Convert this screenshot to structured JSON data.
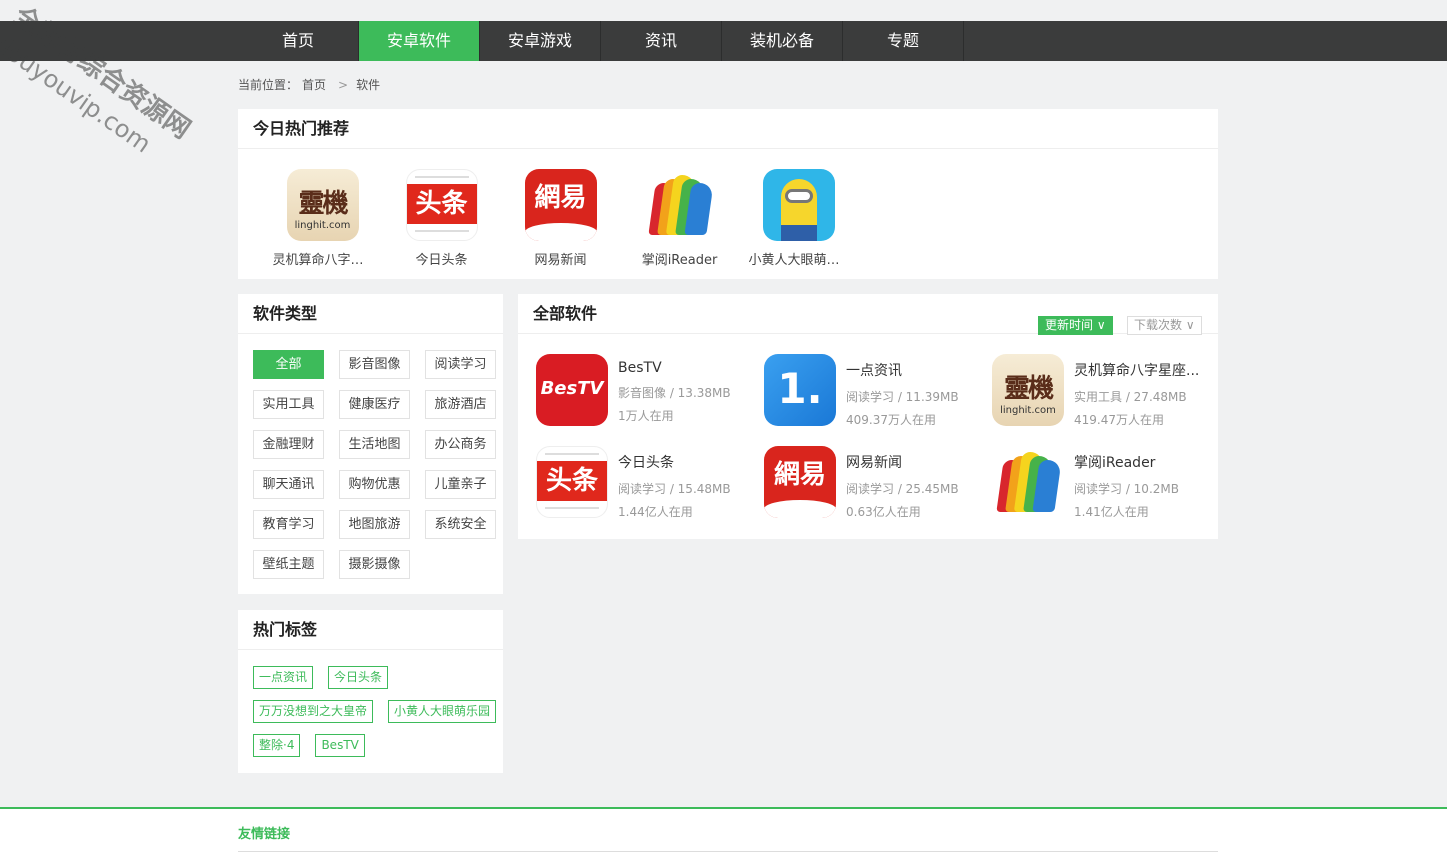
{
  "nav": {
    "items": [
      {
        "label": "首页",
        "active": false
      },
      {
        "label": "安卓软件",
        "active": true
      },
      {
        "label": "安卓游戏",
        "active": false
      },
      {
        "label": "资讯",
        "active": false
      },
      {
        "label": "装机必备",
        "active": false
      },
      {
        "label": "专题",
        "active": false
      }
    ]
  },
  "breadcrumb": {
    "prefix": "当前位置：",
    "home": "首页",
    "separator": ">",
    "current": "软件"
  },
  "hot": {
    "title": "今日热门推荐",
    "items": [
      {
        "name": "灵机算命八字星座...",
        "icon": "linghit-icon"
      },
      {
        "name": "今日头条",
        "icon": "toutiao-icon"
      },
      {
        "name": "网易新闻",
        "icon": "wangyi-news-icon"
      },
      {
        "name": "掌阅iReader",
        "icon": "ireader-icon"
      },
      {
        "name": "小黄人大眼萌乐园",
        "icon": "minion-icon"
      }
    ]
  },
  "categories": {
    "title": "软件类型",
    "items": [
      {
        "label": "全部",
        "active": true
      },
      {
        "label": "影音图像"
      },
      {
        "label": "阅读学习"
      },
      {
        "label": "实用工具"
      },
      {
        "label": "健康医疗"
      },
      {
        "label": "旅游酒店"
      },
      {
        "label": "金融理财"
      },
      {
        "label": "生活地图"
      },
      {
        "label": "办公商务"
      },
      {
        "label": "聊天通讯"
      },
      {
        "label": "购物优惠"
      },
      {
        "label": "儿童亲子"
      },
      {
        "label": "教育学习"
      },
      {
        "label": "地图旅游"
      },
      {
        "label": "系统安全"
      },
      {
        "label": "壁纸主题"
      },
      {
        "label": "摄影摄像"
      }
    ]
  },
  "tags": {
    "title": "热门标签",
    "rows": [
      [
        "一点资讯",
        "今日头条"
      ],
      [
        "万万没想到之大皇帝",
        "小黄人大眼萌乐园"
      ],
      [
        "整除·4",
        "BesTV"
      ]
    ]
  },
  "all": {
    "title": "全部软件",
    "sort_primary": "更新时间 ∨",
    "sort_secondary": "下载次数 ∨",
    "apps": [
      {
        "name": "BesTV",
        "meta": "影音图像 / 13.38MB",
        "users": "1万人在用",
        "icon": "bestv-icon"
      },
      {
        "name": "一点资讯",
        "meta": "阅读学习 / 11.39MB",
        "users": "409.37万人在用",
        "icon": "yidian-icon"
      },
      {
        "name": "灵机算命八字星座...",
        "meta": "实用工具 / 27.48MB",
        "users": "419.47万人在用",
        "icon": "linghit-icon"
      },
      {
        "name": "今日头条",
        "meta": "阅读学习 / 15.48MB",
        "users": "1.44亿人在用",
        "icon": "toutiao-icon"
      },
      {
        "name": "网易新闻",
        "meta": "阅读学习 / 25.45MB",
        "users": "0.63亿人在用",
        "icon": "wangyi-news-icon"
      },
      {
        "name": "掌阅iReader",
        "meta": "阅读学习 / 10.2MB",
        "users": "1.41亿人在用",
        "icon": "ireader-icon"
      }
    ]
  },
  "footer": {
    "title": "友情链接"
  },
  "icon_text": {
    "linghit_main": "靈機",
    "linghit_sub": "linghit.com",
    "toutiao": "头条",
    "wangyi": "網易",
    "bestv": "BesTV",
    "yidian": "1."
  },
  "watermark": {
    "line1": "全都有综合资源网",
    "line2": "douyouvip.com"
  },
  "colors": {
    "accent": "#3dbb5a",
    "nav_bg": "#3b3c3c"
  }
}
